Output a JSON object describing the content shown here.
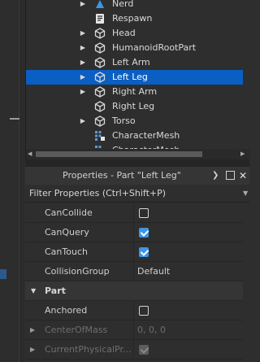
{
  "explorer": {
    "items": [
      {
        "label": "Nerd",
        "arrow": "▶",
        "icon": "accessory-icon"
      },
      {
        "label": "Respawn",
        "arrow": "",
        "icon": "script-icon"
      },
      {
        "label": "Head",
        "arrow": "▶",
        "icon": "part-icon"
      },
      {
        "label": "HumanoidRootPart",
        "arrow": "▶",
        "icon": "part-icon"
      },
      {
        "label": "Left Arm",
        "arrow": "▶",
        "icon": "part-icon"
      },
      {
        "label": "Left Leg",
        "arrow": "▶",
        "icon": "part-icon",
        "selected": true
      },
      {
        "label": "Right Arm",
        "arrow": "▶",
        "icon": "part-icon"
      },
      {
        "label": "Right Leg",
        "arrow": "",
        "icon": "part-icon"
      },
      {
        "label": "Torso",
        "arrow": "▶",
        "icon": "part-icon"
      },
      {
        "label": "CharacterMesh",
        "arrow": "",
        "icon": "mesh-icon"
      },
      {
        "label": "CharacterMesh",
        "arrow": "",
        "icon": "mesh-icon"
      }
    ]
  },
  "properties": {
    "title": "Properties - Part \"Left Leg\"",
    "filter_placeholder": "Filter Properties (Ctrl+Shift+P)",
    "rows": [
      {
        "name": "CanCollide",
        "type": "checkbox",
        "checked": false
      },
      {
        "name": "CanQuery",
        "type": "checkbox",
        "checked": true
      },
      {
        "name": "CanTouch",
        "type": "checkbox",
        "checked": true
      },
      {
        "name": "CollisionGroup",
        "type": "text",
        "value": "Default"
      }
    ],
    "section": "Part",
    "part_rows": [
      {
        "name": "Anchored",
        "type": "checkbox",
        "checked": false
      },
      {
        "name": "CenterOfMass",
        "type": "text",
        "value": "0, 0, 0",
        "disabled": true
      },
      {
        "name": "CurrentPhysicalPr...",
        "type": "checkbox",
        "checked": true,
        "disabled": true
      }
    ]
  },
  "colors": {
    "selection": "#0b5ec2",
    "checkbox_on": "#3b96e6",
    "background": "#2e2e2e"
  }
}
